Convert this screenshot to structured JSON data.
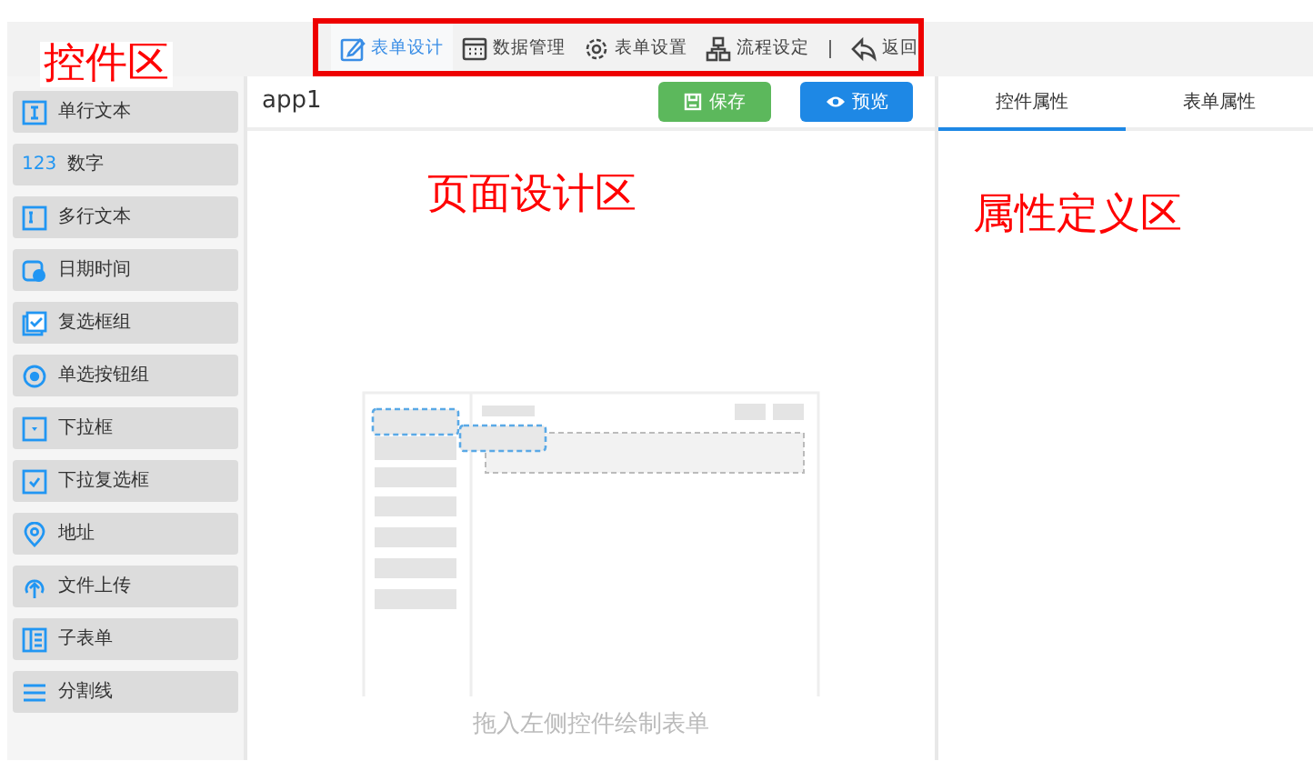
{
  "annotation_labels": [
    "控件区",
    "页面设计区",
    "属性定义区"
  ],
  "toolbar": {
    "items": [
      {
        "label": "表单设计",
        "selected": true
      },
      {
        "label": "数据管理",
        "selected": false
      },
      {
        "label": "表单设置",
        "selected": false
      },
      {
        "label": "流程设定",
        "selected": false
      },
      {
        "label": "返回",
        "selected": false
      }
    ]
  },
  "palette": {
    "items": [
      {
        "label": "单行文本"
      },
      {
        "label": "数字",
        "icon_text": "123"
      },
      {
        "label": "多行文本"
      },
      {
        "label": "日期时间"
      },
      {
        "label": "复选框组"
      },
      {
        "label": "单选按钮组"
      },
      {
        "label": "下拉框"
      },
      {
        "label": "下拉复选框"
      },
      {
        "label": "地址"
      },
      {
        "label": "文件上传"
      },
      {
        "label": "子表单"
      },
      {
        "label": "分割线"
      }
    ]
  },
  "canvas": {
    "title": "app1",
    "buttons": [
      {
        "label": "保存",
        "kind": "save"
      },
      {
        "label": "预览",
        "kind": "preview"
      }
    ],
    "empty_hint": "拖入左侧控件绘制表单"
  },
  "properties": {
    "tabs": [
      {
        "label": "控件属性",
        "selected": true
      },
      {
        "label": "表单属性",
        "selected": false
      }
    ]
  }
}
